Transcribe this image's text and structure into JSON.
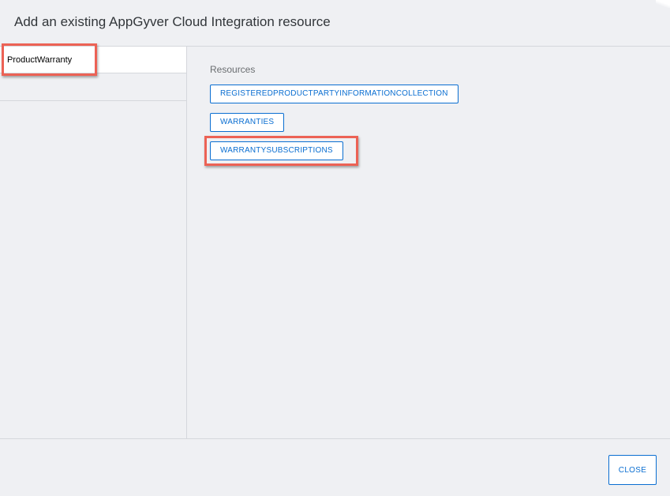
{
  "dialog": {
    "title": "Add an existing AppGyver Cloud Integration resource"
  },
  "sidebar": {
    "items": [
      {
        "label": "ProductWarranty",
        "selected": true
      }
    ]
  },
  "main": {
    "section_label": "Resources",
    "resources": [
      {
        "label": "REGISTEREDPRODUCTPARTYINFORMATIONCOLLECTION"
      },
      {
        "label": "WARRANTIES"
      },
      {
        "label": "WARRANTYSUBSCRIPTIONS"
      }
    ]
  },
  "footer": {
    "close_label": "CLOSE"
  },
  "colors": {
    "accent": "#0a6ed1",
    "highlight": "#ec6255",
    "background": "#eff0f3"
  }
}
